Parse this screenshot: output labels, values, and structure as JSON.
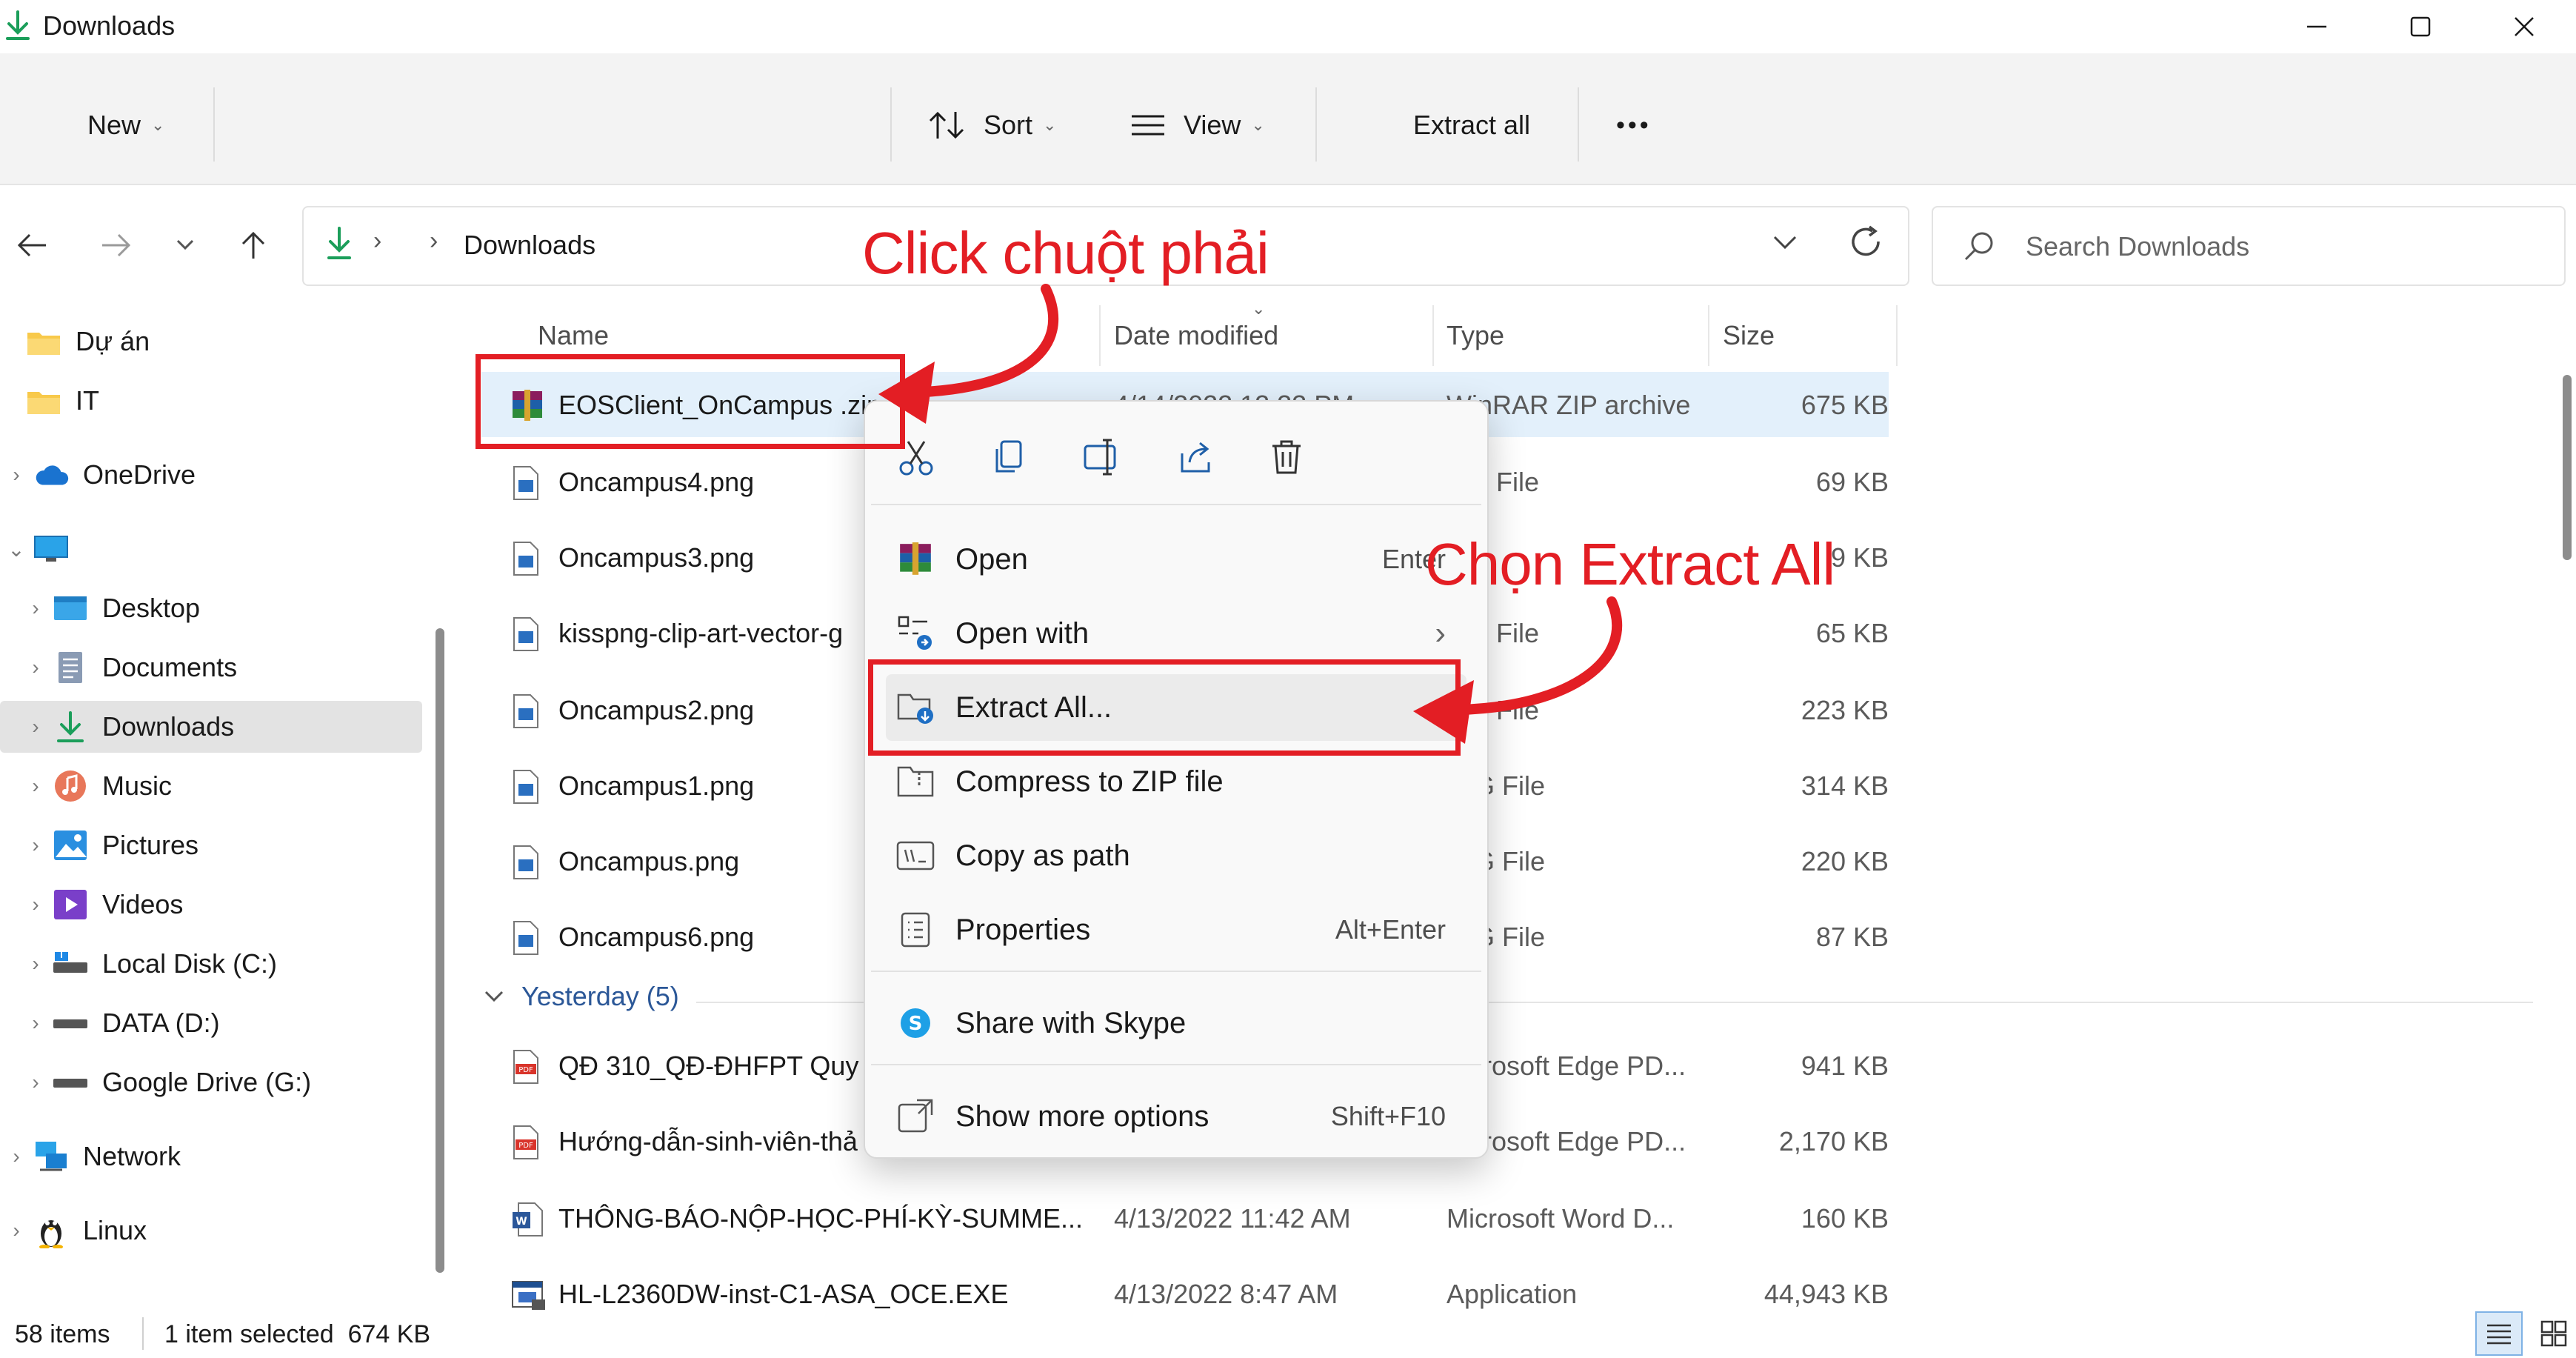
{
  "window": {
    "title": "Downloads",
    "minimize_icon": "minimize-icon",
    "maximize_icon": "maximize-icon",
    "close_icon": "close-icon"
  },
  "toolbar": {
    "new_label": "New",
    "sort_label": "Sort",
    "view_label": "View",
    "extract_all_label": "Extract all",
    "more_label": "•••"
  },
  "nav": {
    "breadcrumb_current": "Downloads",
    "search_placeholder": "Search Downloads"
  },
  "sidebar": {
    "items": [
      {
        "label": "Dự án",
        "icon": "folder-icon"
      },
      {
        "label": "IT",
        "icon": "folder-icon"
      },
      {
        "label": "OneDrive",
        "icon": "cloud-icon"
      },
      {
        "label": "",
        "icon": "monitor-icon"
      },
      {
        "label": "Desktop",
        "icon": "desktop-icon"
      },
      {
        "label": "Documents",
        "icon": "documents-icon"
      },
      {
        "label": "Downloads",
        "icon": "download-icon"
      },
      {
        "label": "Music",
        "icon": "music-icon"
      },
      {
        "label": "Pictures",
        "icon": "pictures-icon"
      },
      {
        "label": "Videos",
        "icon": "videos-icon"
      },
      {
        "label": "Local Disk (C:)",
        "icon": "drive-icon"
      },
      {
        "label": "DATA (D:)",
        "icon": "drive-icon"
      },
      {
        "label": "Google Drive (G:)",
        "icon": "drive-icon"
      },
      {
        "label": "Network",
        "icon": "network-icon"
      },
      {
        "label": "Linux",
        "icon": "linux-icon"
      }
    ]
  },
  "columns": {
    "name": "Name",
    "date": "Date modified",
    "type": "Type",
    "size": "Size"
  },
  "files": [
    {
      "name": "EOSClient_OnCampus .zip",
      "date": "4/14/2022 12:33 PM",
      "type": "WinRAR ZIP archive",
      "size": "675 KB",
      "icon": "winrar-icon"
    },
    {
      "name": "Oncampus4.png",
      "date": "",
      "type": "G File",
      "size": "69 KB",
      "icon": "image-file-icon"
    },
    {
      "name": "Oncampus3.png",
      "date": "",
      "type": "",
      "size": "9 KB",
      "icon": "image-file-icon"
    },
    {
      "name": "kisspng-clip-art-vector-g",
      "date": "",
      "type": "File",
      "size": "65 KB",
      "icon": "image-file-icon"
    },
    {
      "name": "Oncampus2.png",
      "date": "",
      "type": "File",
      "size": "223 KB",
      "icon": "image-file-icon"
    },
    {
      "name": "Oncampus1.png",
      "date": "",
      "type": "G File",
      "size": "314 KB",
      "icon": "image-file-icon"
    },
    {
      "name": "Oncampus.png",
      "date": "",
      "type": "G File",
      "size": "220 KB",
      "icon": "image-file-icon"
    },
    {
      "name": "Oncampus6.png",
      "date": "",
      "type": "G File",
      "size": "87 KB",
      "icon": "image-file-icon"
    }
  ],
  "group": {
    "label": "Yesterday (5)"
  },
  "files_yesterday": [
    {
      "name": "QĐ 310_QĐ-ĐHFPT Quy",
      "date": "",
      "type": "rosoft Edge PD...",
      "size": "941 KB",
      "icon": "pdf-icon"
    },
    {
      "name": "Hướng-dẫn-sinh-viên-thả",
      "date": "",
      "type": "rosoft Edge PD...",
      "size": "2,170 KB",
      "icon": "pdf-icon"
    },
    {
      "name": "THÔNG-BÁO-NỘP-HỌC-PHÍ-KỲ-SUMME...",
      "date": "4/13/2022 11:42 AM",
      "type": "Microsoft Word D...",
      "size": "160 KB",
      "icon": "word-icon"
    },
    {
      "name": "HL-L2360DW-inst-C1-ASA_OCE.EXE",
      "date": "4/13/2022 8:47 AM",
      "type": "Application",
      "size": "44,943 KB",
      "icon": "exe-icon"
    }
  ],
  "status": {
    "items_count": "58 items",
    "selection": "1 item selected  674 KB"
  },
  "context_menu": {
    "quick_actions": [
      "cut-icon",
      "copy-icon",
      "rename-icon",
      "share-icon",
      "delete-icon"
    ],
    "items": [
      {
        "label": "Open",
        "shortcut": "Enter",
        "icon": "winrar-icon"
      },
      {
        "label": "Open with",
        "shortcut": "›",
        "icon": "open-with-icon"
      },
      {
        "label": "Extract All...",
        "shortcut": "",
        "icon": "extract-icon"
      },
      {
        "label": "Compress to ZIP file",
        "shortcut": "",
        "icon": "zip-icon"
      },
      {
        "label": "Copy as path",
        "shortcut": "",
        "icon": "copy-path-icon"
      },
      {
        "label": "Properties",
        "shortcut": "Alt+Enter",
        "icon": "properties-icon"
      },
      {
        "label": "Share with Skype",
        "shortcut": "",
        "icon": "skype-icon"
      },
      {
        "label": "Show more options",
        "shortcut": "Shift+F10",
        "icon": "more-options-icon"
      }
    ]
  },
  "annotations": {
    "right_click": "Click chuột phải",
    "choose_extract": "Chọn Extract All"
  },
  "colors": {
    "accent": "#0067c0",
    "annotation_red": "#e31e24",
    "selection": "#cce4f7"
  }
}
